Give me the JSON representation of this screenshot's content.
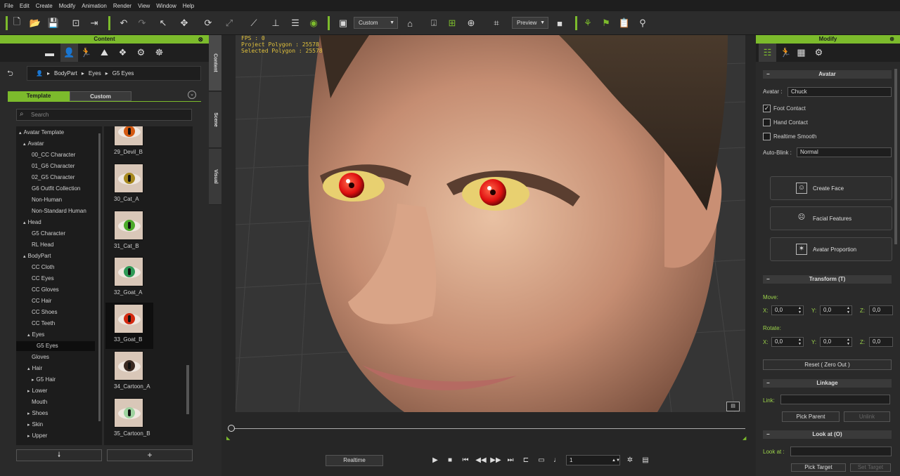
{
  "menu": [
    "File",
    "Edit",
    "Create",
    "Modify",
    "Animation",
    "Render",
    "View",
    "Window",
    "Help"
  ],
  "toolbar": {
    "view_combo": "Custom",
    "preview_combo": "Preview"
  },
  "content_panel": {
    "title": "Content",
    "breadcrumb": [
      "BodyPart",
      "Eyes",
      "G5 Eyes"
    ],
    "tabs": {
      "template": "Template",
      "custom": "Custom"
    },
    "search_placeholder": "Search",
    "tree": [
      {
        "label": "Avatar Template",
        "arrow": "▴"
      },
      {
        "label": "Avatar",
        "arrow": "▴"
      },
      {
        "label": "00_CC Character",
        "arrow": ""
      },
      {
        "label": "01_G6 Character",
        "arrow": ""
      },
      {
        "label": "02_G5 Character",
        "arrow": ""
      },
      {
        "label": "G6 Outfit Collection",
        "arrow": ""
      },
      {
        "label": "Non-Human",
        "arrow": ""
      },
      {
        "label": "Non-Standard Human",
        "arrow": ""
      },
      {
        "label": "Head",
        "arrow": "▴"
      },
      {
        "label": "G5 Character",
        "arrow": ""
      },
      {
        "label": "RL Head",
        "arrow": ""
      },
      {
        "label": "BodyPart",
        "arrow": "▴"
      },
      {
        "label": "CC Cloth",
        "arrow": ""
      },
      {
        "label": "CC Eyes",
        "arrow": ""
      },
      {
        "label": "CC Gloves",
        "arrow": ""
      },
      {
        "label": "CC Hair",
        "arrow": ""
      },
      {
        "label": "CC Shoes",
        "arrow": ""
      },
      {
        "label": "CC Teeth",
        "arrow": ""
      },
      {
        "label": "Eyes",
        "arrow": "▴"
      },
      {
        "label": "G5 Eyes",
        "arrow": ""
      },
      {
        "label": "Gloves",
        "arrow": ""
      },
      {
        "label": "Hair",
        "arrow": "▴"
      },
      {
        "label": "G5 Hair",
        "arrow": "▸"
      },
      {
        "label": "Lower",
        "arrow": "▸"
      },
      {
        "label": "Mouth",
        "arrow": ""
      },
      {
        "label": "Shoes",
        "arrow": "▸"
      },
      {
        "label": "Skin",
        "arrow": "▸"
      },
      {
        "label": "Upper",
        "arrow": "▸"
      }
    ],
    "thumbnails": [
      {
        "label": "29_Devil_B",
        "iris": "#d45a12"
      },
      {
        "label": "30_Cat_A",
        "iris": "#a7891f"
      },
      {
        "label": "31_Cat_B",
        "iris": "#4caa2a"
      },
      {
        "label": "32_Goat_A",
        "iris": "#2f9a57"
      },
      {
        "label": "33_Goat_B",
        "iris": "#d22a10"
      },
      {
        "label": "34_Cartoon_A",
        "iris": "#3a2a22"
      },
      {
        "label": "35_Cartoon_B",
        "iris": "#9fd3a0"
      }
    ]
  },
  "side_tabs": [
    "Content",
    "Scene",
    "Visual"
  ],
  "viewport": {
    "fps": "FPS : 0",
    "project_polygon": "Project Polygon : 25578",
    "selected_polygon": "Selected Polygon : 25578"
  },
  "playback": {
    "realtime": "Realtime",
    "frame": "1"
  },
  "modify_panel": {
    "title": "Modify",
    "avatar_section": "Avatar",
    "avatar_label": "Avatar :",
    "avatar_value": "Chuck",
    "foot_contact": "Foot Contact",
    "hand_contact": "Hand Contact",
    "realtime_smooth": "Realtime Smooth",
    "auto_blink_label": "Auto-Blink :",
    "auto_blink_value": "Normal",
    "create_face": "Create Face",
    "facial_features": "Facial Features",
    "avatar_proportion": "Avatar Proportion",
    "transform_section": "Transform  (T)",
    "move_label": "Move:",
    "rotate_label": "Rotate:",
    "x_label": "X:",
    "y_label": "Y:",
    "z_label": "Z:",
    "move": {
      "x": "0,0",
      "y": "0,0",
      "z": "0,0"
    },
    "rotate": {
      "x": "0,0",
      "y": "0,0",
      "z": "0,0"
    },
    "reset": "Reset ( Zero Out )",
    "linkage_section": "Linkage",
    "link_label": "Link:",
    "pick_parent": "Pick Parent",
    "unlink": "Unlink",
    "lookat_section": "Look at  (O)",
    "lookat_label": "Look at :",
    "pick_target": "Pick Target",
    "set_target": "Set Target"
  },
  "colors": {
    "accent": "#7cbb2c",
    "panel": "#2a2a2a",
    "stats": "#e2c23c"
  }
}
